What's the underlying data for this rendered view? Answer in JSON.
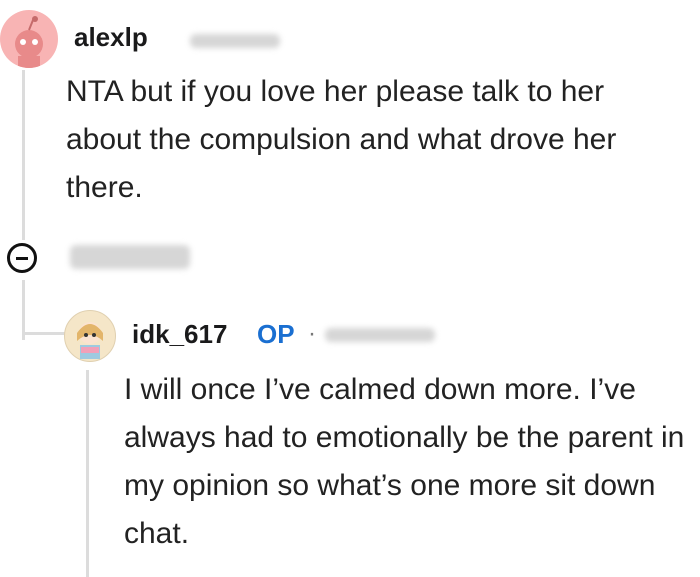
{
  "comment": {
    "author": "alexlp",
    "text": "NTA but if you love her please talk to her about the compulsion and what drove her there."
  },
  "reply": {
    "author": "idk_617",
    "op_badge": "OP",
    "separator": "·",
    "text": "I will once I’ve calmed down more. I’ve always had to emotionally be the parent in my opinion so what’s one more sit down chat."
  },
  "icons": {
    "collapse": "collapse-minus-icon",
    "avatar1": "reddit-snoo-avatar",
    "avatar2": "custom-snoo-avatar"
  },
  "colors": {
    "op_blue": "#1a6fd1",
    "avatar1_bg": "#f8b4b4"
  }
}
